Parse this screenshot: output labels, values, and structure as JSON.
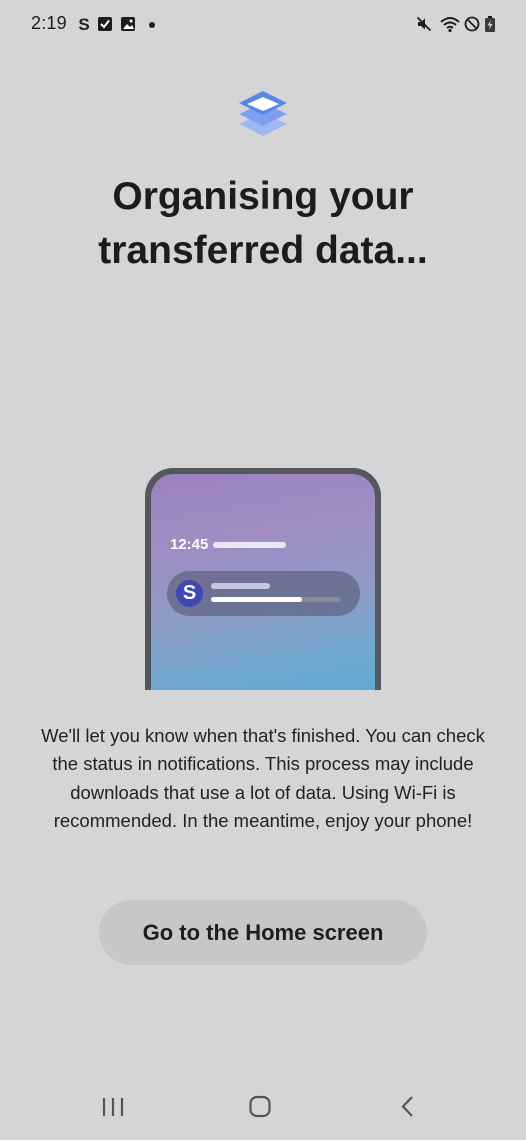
{
  "status_bar": {
    "time": "2:19",
    "left_icons": [
      "s-app-icon",
      "checkbox-icon",
      "image-icon"
    ],
    "right_icons": [
      "mute-icon",
      "wifi-icon",
      "do-not-disturb-icon",
      "battery-charging-icon"
    ]
  },
  "header": {
    "icon": "layers-icon",
    "title": "Organising your transferred data..."
  },
  "illustration": {
    "clock": "12:45",
    "avatar_letter": "S",
    "progress": 0.7
  },
  "body": {
    "description": "We'll let you know when that's finished. You can check the status in notifications. This process may include downloads that use a lot of data. Using Wi-Fi is recommended. In the meantime, enjoy your phone!"
  },
  "actions": {
    "home_button_label": "Go to the Home screen"
  },
  "nav_bar": {
    "buttons": [
      "recent-apps-icon",
      "home-icon",
      "back-icon"
    ]
  },
  "colors": {
    "background": "#d5d5d7",
    "button": "#c7c7c9",
    "accent": "#5b86e8"
  }
}
